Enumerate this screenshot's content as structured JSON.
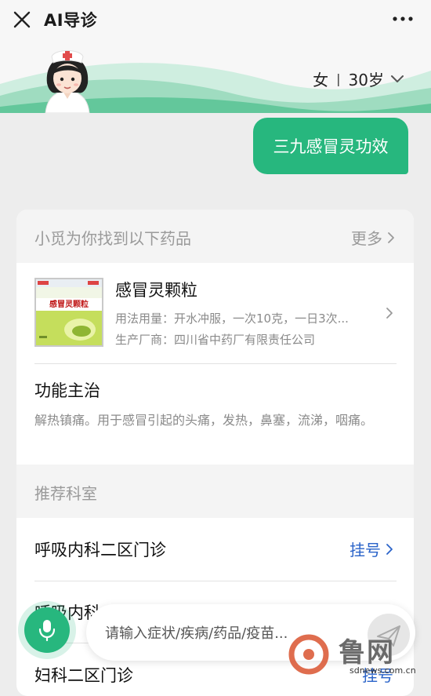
{
  "header": {
    "title": "AI导诊"
  },
  "profile": {
    "gender": "女",
    "separator": "|",
    "age": "30岁"
  },
  "chat": {
    "user_message": "三九感冒灵功效"
  },
  "drugs_section": {
    "heading": "小觅为你找到以下药品",
    "more": "更多"
  },
  "drug": {
    "name": "感冒灵颗粒",
    "package_label": "感冒灵颗粒",
    "usage": "用法用量：开水冲服，一次10克，一日3次...",
    "manufacturer": "生产厂商：四川省中药厂有限责任公司"
  },
  "function": {
    "title": "功能主治",
    "text": "解热镇痛。用于感冒引起的头痛，发热，鼻塞，流涕，咽痛。"
  },
  "departments": {
    "heading": "推荐科室",
    "items": [
      {
        "name": "呼吸内科二区门诊",
        "action": "挂号"
      },
      {
        "name": "呼吸内科一区门诊",
        "action": "挂号"
      },
      {
        "name": "妇科二区门诊",
        "action": "挂号"
      }
    ]
  },
  "input": {
    "placeholder": "请输入症状/疾病/药品/疫苗..."
  },
  "watermark": {
    "brand": "鲁网",
    "url": "sdnews.com.cn"
  },
  "colors": {
    "accent": "#27b77e",
    "link": "#2a63c9",
    "muted": "#9a9a9a"
  },
  "icons": [
    "close-icon",
    "more-icon",
    "chevron-down-icon",
    "chevron-right-icon",
    "mic-icon",
    "send-icon"
  ]
}
